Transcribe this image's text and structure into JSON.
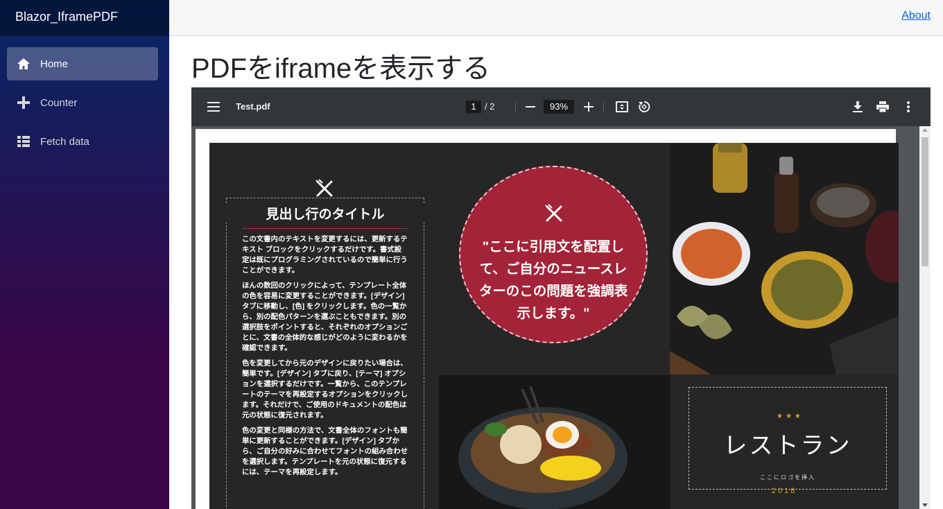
{
  "app": {
    "brand": "Blazor_IframePDF"
  },
  "sidebar": {
    "items": [
      {
        "label": "Home",
        "icon": "home-icon",
        "active": true
      },
      {
        "label": "Counter",
        "icon": "plus-icon",
        "active": false
      },
      {
        "label": "Fetch data",
        "icon": "list-icon",
        "active": false
      }
    ]
  },
  "topbar": {
    "about_label": "About"
  },
  "page": {
    "title": "PDFをiframeを表示する"
  },
  "pdf_viewer": {
    "file_name": "Test.pdf",
    "current_page": "1",
    "page_total": "/  2",
    "zoom": "93%"
  },
  "pdf_content": {
    "heading": "見出し行のタイトル",
    "paragraphs": [
      "この文書内のテキストを変更するには、更新するテキスト ブロックをクリックするだけです。書式設定は既にプログラミングされているので簡単に行うことができます。",
      "ほんの数回のクリックによって、テンプレート全体の色を容易に変更することができます。[デザイン] タブに移動し、[色] をクリックします。色の一覧から、別の配色パターンを選ぶこともできます。別の選択肢をポイントすると、それぞれのオプションごとに、文書の全体的な感じがどのように変わるかを確認できます。",
      "色を変更してから元のデザインに戻りたい場合は、簡単です。[デザイン] タブに戻り、[テーマ] オプションを選択するだけです。一覧から、このテンプレートのテーマを再設定するオプションをクリックします。それだけで、ご使用のドキュメントの配色は元の状態に復元されます。",
      "色の変更と同様の方法で、文書全体のフォントも簡単に更新することができます。[デザイン] タブから、ご自分の好みに合わせてフォントの組み合わせを選択します。テンプレートを元の状態に復元するには、テーマを再設定します。"
    ],
    "quote": "\"ここに引用文を配置して、ご自分のニュースレターのこの問題を強調表示します。\"",
    "logo_text": "レストラン",
    "logo_sub": "ここにロゴを挿入",
    "logo_year": "2018"
  },
  "colors": {
    "sidebar_top": "#052767",
    "sidebar_bottom": "#3a0647",
    "link": "#0366d6",
    "pdf_toolbar": "#323639",
    "quote_circle": "#a32438"
  }
}
